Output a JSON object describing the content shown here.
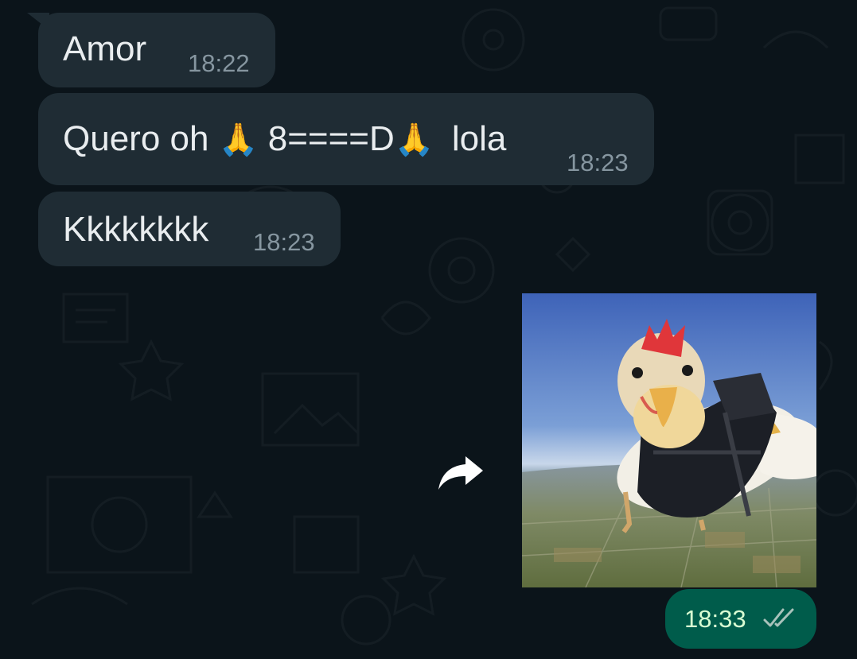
{
  "messages": [
    {
      "text": "Amor",
      "time": "18:22"
    },
    {
      "text_before": "Quero oh",
      "emoji_hand": "🙏",
      "text_mid": "8====D",
      "text_after": "lola",
      "time": "18:23"
    },
    {
      "text": "Kkkkkkkk",
      "time": "18:23"
    }
  ],
  "outgoing": {
    "media_description_icon": "chicken-skydiving-image",
    "time": "18:33",
    "status": "read"
  },
  "colors": {
    "background": "#0b141a",
    "incoming_bubble": "#1f2c34",
    "outgoing_bubble": "#005c4b",
    "meta_text": "#8696a0"
  },
  "icons": {
    "forward": "forward-arrow-icon",
    "read_receipt": "double-check-icon"
  }
}
